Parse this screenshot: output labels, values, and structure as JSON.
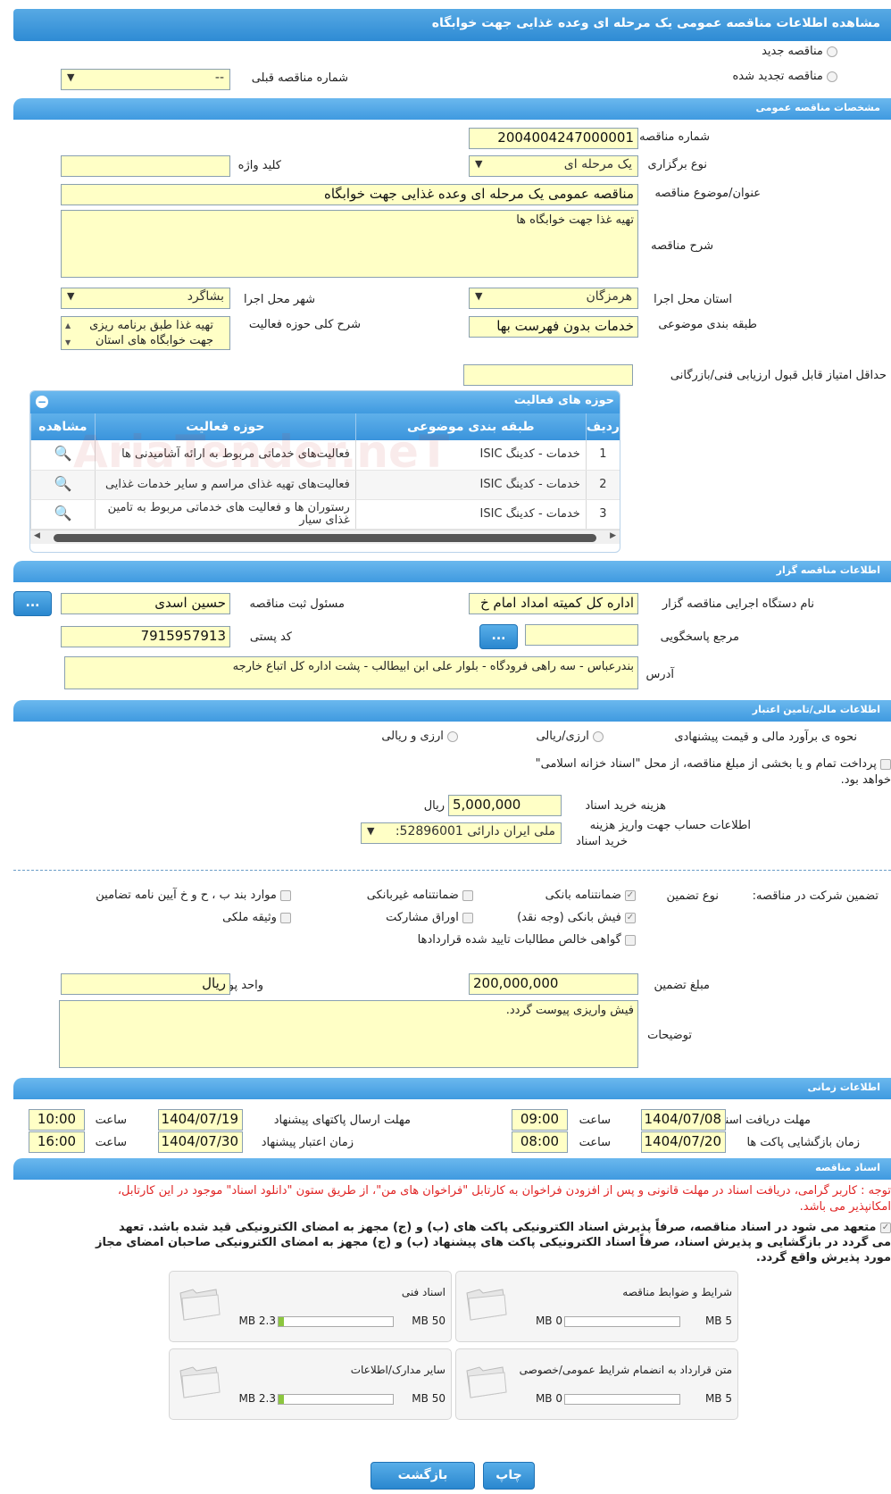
{
  "title": "مشاهده اطلاعات مناقصه عمومی یک مرحله ای وعده غذایی جهت خوابگاه",
  "top": {
    "new_tender": "مناقصه جدید",
    "renewed_tender": "مناقصه تجدید شده",
    "prev_tender_label": "شماره مناقصه قبلی",
    "prev_tender_value": "--"
  },
  "general": {
    "header": "مشخصات مناقصه عمومی",
    "tender_no_label": "شماره مناقصه",
    "tender_no": "2004004247000001",
    "type_label": "نوع برگزاری",
    "type_value": "یک مرحله ای",
    "keyword_label": "کلید واژه",
    "keyword_value": "",
    "subject_label": "عنوان/موضوع مناقصه",
    "subject_value": "مناقصه عمومی یک مرحله ای وعده غذایی جهت خوابگاه",
    "desc_label": "شرح مناقصه",
    "desc_value": "تهیه غذا جهت خوابگاه ها",
    "province_label": "استان محل اجرا",
    "province_value": "هرمزگان",
    "city_label": "شهر محل اجرا",
    "city_value": "بشاگرد",
    "category_label": "طبقه بندی موضوعی",
    "category_value": "خدمات بدون فهرست بها",
    "activity_desc_label": "شرح کلی حوزه فعالیت",
    "activity_desc_line1": "تهیه غذا طبق برنامه ریزی",
    "activity_desc_line2": "جهت خوابگاه های استان",
    "min_score_label": "حداقل امتیاز قابل قبول ارزیابی فنی/بازرگانی",
    "min_score_value": ""
  },
  "activities": {
    "header": "حوزه های فعالیت",
    "columns": [
      "ردیف",
      "طبقه بندی موضوعی",
      "حوزه فعالیت",
      "مشاهده"
    ],
    "rows": [
      {
        "no": "1",
        "category": "خدمات - کدینگ ISIC",
        "field": "فعالیت‌های خدماتی مربوط به ارائه آشامیدنی ها"
      },
      {
        "no": "2",
        "category": "خدمات - کدینگ ISIC",
        "field": "فعالیت‌های تهیه غذای مراسم و سایر خدمات غذایی"
      },
      {
        "no": "3",
        "category": "خدمات - کدینگ ISIC",
        "field": "رستوران ها و فعالیت های خدماتی مربوط به تامین غذای سیار"
      }
    ],
    "watermark": "AriaTender.neT"
  },
  "organizer": {
    "header": "اطلاعات مناقصه گزار",
    "org_label": "نام دستگاه اجرایی مناقصه گزار",
    "org_value": "اداره کل کمیته امداد امام خ",
    "resp_label": "مسئول ثبت مناقصه",
    "resp_value": "حسین اسدی",
    "ref_label": "مرجع پاسخگویی",
    "ref_value": "",
    "postal_label": "کد پستی",
    "postal_value": "7915957913",
    "address_label": "آدرس",
    "address_value": "بندرعباس - سه راهی فرودگاه - بلوار علی ابن ابیطالب - پشت اداره کل اتباع خارجه",
    "dots": "..."
  },
  "finance": {
    "header": "اطلاعات مالی/تامین اعتبار",
    "estimate_label": "نحوه ی برآورد مالی و قیمت پیشنهادی",
    "opt_rial": "ارزی/ریالی",
    "opt_fx": "ارزی و ریالی",
    "treasury_text": "پرداخت تمام و یا بخشی از مبلغ مناقصه، از محل \"اسناد خزانه اسلامی\"",
    "treasury_text2": "خواهد بود.",
    "doc_cost_label": "هزینه خرید اسناد",
    "doc_cost_value": "5,000,000",
    "doc_cost_unit": "ریال",
    "account_label_1": "اطلاعات حساب جهت واریز هزینه",
    "account_label_2": "خرید اسناد",
    "account_value": "ملی ایران دارائی 52896001:"
  },
  "guarantee": {
    "label": "تضمین شرکت در مناقصه:",
    "type_label": "نوع تضمین",
    "items": {
      "bank_guarantee": "ضمانتنامه بانکی",
      "nonbank_guarantee": "ضمانتنامه غیربانکی",
      "clauses": "موارد بند ب ، ح و خ آیین نامه تضامین",
      "cash_receipt": "فیش بانکی (وجه نقد)",
      "bonds": "اوراق مشارکت",
      "property": "وثیقه ملکی",
      "receivables": "گواهی خالص مطالبات تایید شده قراردادها"
    },
    "amount_label": "مبلغ تضمین",
    "amount_value": "200,000,000",
    "currency_label": "واحد پول",
    "currency_value": "ریال",
    "notes_label": "توضیحات",
    "notes_value": "فیش واریزی پیوست گردد."
  },
  "timing": {
    "header": "اطلاعات زمانی",
    "receive_label": "مهلت دریافت اسناد",
    "receive_date": "1404/07/08",
    "receive_time": "09:00",
    "send_label": "مهلت ارسال پاکتهای پیشنهاد",
    "send_date": "1404/07/19",
    "send_time": "10:00",
    "open_label": "زمان بازگشایی پاکت ها",
    "open_date": "1404/07/20",
    "open_time": "08:00",
    "validity_label": "زمان اعتبار پیشنهاد",
    "validity_date": "1404/07/30",
    "validity_time": "16:00",
    "time_label": "ساعت"
  },
  "documents": {
    "header": "اسناد مناقصه",
    "notice_1": "توجه : کاربر گرامی، دریافت اسناد در مهلت قانونی و پس از افزودن فراخوان به کارتابل \"فراخوان های من\"، از طریق ستون \"دانلود اسناد\" موجود در این کارتابل،",
    "notice_2": "امکانپذیر می باشد.",
    "commit_1": "متعهد می شود در اسناد مناقصه، صرفاً پذیرش اسناد الکترونیکی پاکت های (ب) و (ج) مجهز به امضای الکترونیکی قید شده باشد. تعهد",
    "commit_2": "می گردد در بازگشایی و پذیرش اسناد، صرفاً اسناد الکترونیکی پاکت های پیشنهاد (ب) و (ج) مجهز به امضای الکترونیکی صاحبان امضای مجاز",
    "commit_3": "مورد پذیرش واقع گردد.",
    "boxes": [
      {
        "title": "شرایط و ضوابط مناقصه",
        "max": "5 MB",
        "used": "0 MB",
        "fill": 0.0
      },
      {
        "title": "اسناد فنی",
        "max": "50 MB",
        "used": "2.3 MB",
        "fill": 0.046
      },
      {
        "title": "متن قرارداد به انضمام شرایط عمومی/خصوصی",
        "max": "5 MB",
        "used": "0 MB",
        "fill": 0.0
      },
      {
        "title": "سایر مدارک/اطلاعات",
        "max": "50 MB",
        "used": "2.3 MB",
        "fill": 0.046
      }
    ]
  },
  "actions": {
    "back": "بازگشت",
    "print": "چاپ"
  }
}
